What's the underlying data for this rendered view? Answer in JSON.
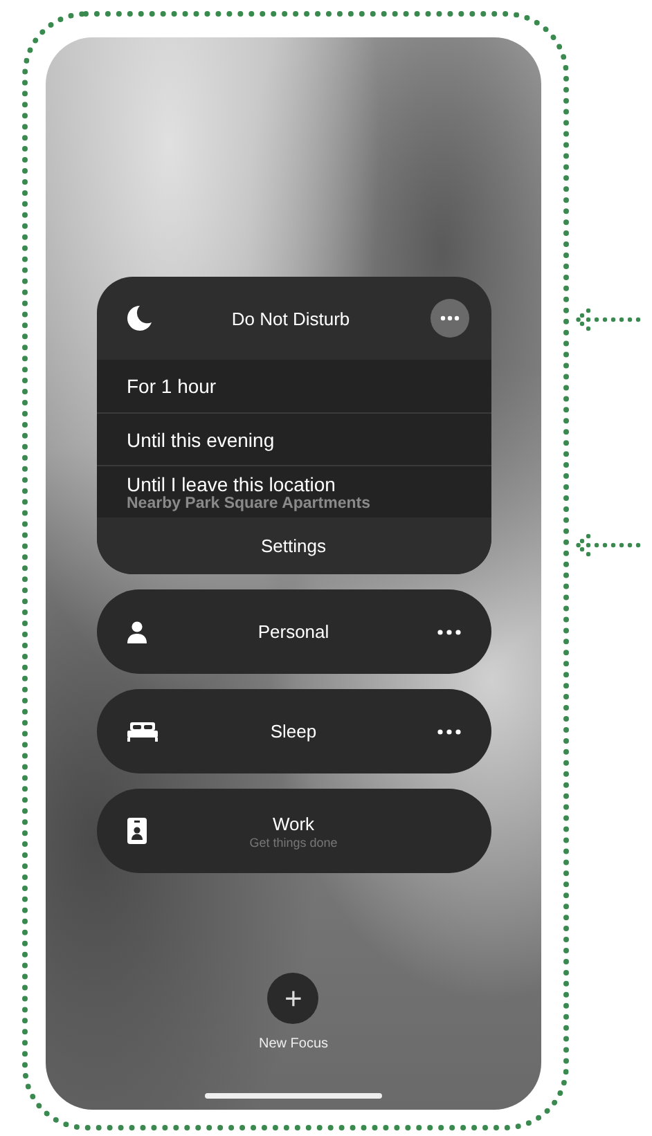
{
  "focus_card": {
    "title": "Do Not Disturb",
    "expanded": true,
    "options": [
      {
        "label": "For 1 hour"
      },
      {
        "label": "Until this evening"
      },
      {
        "label": "Until I leave this location",
        "detail": "Nearby Park Square Apartments"
      }
    ],
    "settings": "Settings"
  },
  "focuses": [
    {
      "kind": "personal",
      "name": "Personal",
      "more": true
    },
    {
      "kind": "sleep",
      "name": "Sleep",
      "more": true
    },
    {
      "kind": "work",
      "name": "Work",
      "subtitle": "Get things done",
      "more": false
    }
  ],
  "new_focus": {
    "symbol": "+",
    "label": "New Focus"
  }
}
